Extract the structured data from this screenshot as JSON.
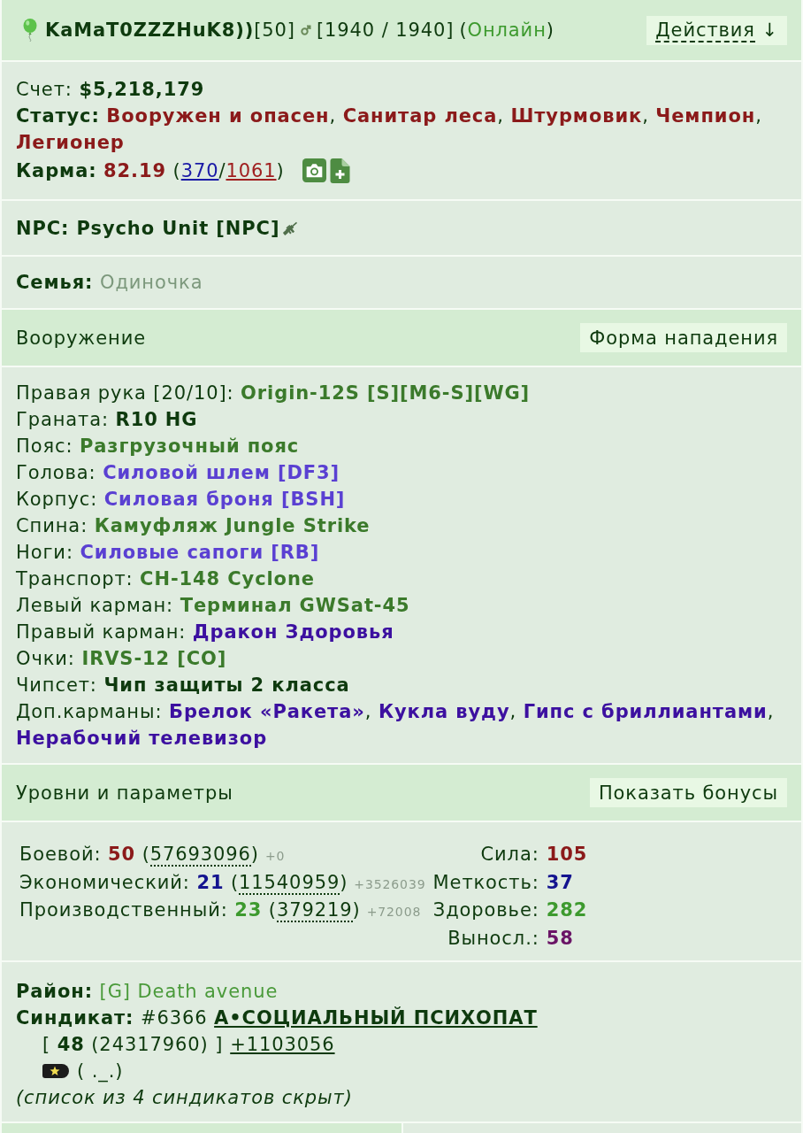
{
  "header": {
    "name": "KaMaT0ZZZHuK8))",
    "level": "[50]",
    "health": "[1940 / 1940]",
    "online_status": {
      "open": "(",
      "label": "Онлайн",
      "close": ")"
    },
    "actions_button": {
      "label": "Действия",
      "arrow": "↓"
    }
  },
  "account": {
    "label": "Счет:",
    "value": "$5,218,179"
  },
  "status": {
    "label": "Статус:",
    "titles": [
      "Вооружен и опасен",
      "Санитар леса",
      "Штурмовик",
      "Чемпион",
      "Легионер"
    ],
    "separator": ","
  },
  "karma": {
    "label": "Карма:",
    "value": "82.19",
    "open": "(",
    "plus_votes": "370",
    "slash": "/",
    "minus_votes": "1061",
    "close": ")"
  },
  "npc": {
    "label": "NPC:",
    "name": "Psycho Unit [NPC]"
  },
  "family": {
    "label": "Семья:",
    "value": "Одиночка"
  },
  "weapons_section": {
    "title": "Вооружение",
    "button": "Форма нападения"
  },
  "equipment": {
    "separator": ",",
    "slots": [
      {
        "label": "Правая рука [20/10]:",
        "items": [
          {
            "name": "Origin-12S [S][M6-S][WG]",
            "color": "#3b7a2b"
          }
        ]
      },
      {
        "label": "Граната:",
        "items": [
          {
            "name": "R10 HG",
            "color": "#0e3a0e"
          }
        ]
      },
      {
        "label": "Пояс:",
        "items": [
          {
            "name": "Разгрузочный пояс",
            "color": "#3b7a2b"
          }
        ]
      },
      {
        "label": "Голова:",
        "items": [
          {
            "name": "Силовой шлем [DF3]",
            "color": "#5a40d2"
          }
        ]
      },
      {
        "label": "Корпус:",
        "items": [
          {
            "name": "Силовая броня [BSH]",
            "color": "#5a40d2"
          }
        ]
      },
      {
        "label": "Спина:",
        "items": [
          {
            "name": "Камуфляж Jungle Strike",
            "color": "#3b7a2b"
          }
        ]
      },
      {
        "label": "Ноги:",
        "items": [
          {
            "name": "Силовые сапоги [RB]",
            "color": "#5a40d2"
          }
        ]
      },
      {
        "label": "Транспорт:",
        "items": [
          {
            "name": "CH-148 Cyclone",
            "color": "#3b7a2b"
          }
        ]
      },
      {
        "label": "Левый карман:",
        "items": [
          {
            "name": "Терминал GWSat-45",
            "color": "#3b7a2b"
          }
        ]
      },
      {
        "label": "Правый карман:",
        "items": [
          {
            "name": "Дракон Здоровья",
            "color": "#3c10a0"
          }
        ]
      },
      {
        "label": "Очки:",
        "items": [
          {
            "name": "IRVS-12 [CO]",
            "color": "#3b7a2b"
          }
        ]
      },
      {
        "label": "Чипсет:",
        "items": [
          {
            "name": "Чип защиты 2 класса",
            "color": "#0e3a0e"
          }
        ]
      },
      {
        "label": "Доп.карманы:",
        "items": [
          {
            "name": "Брелок «Ракета»",
            "color": "#3c10a0"
          },
          {
            "name": "Кукла вуду",
            "color": "#3c10a0"
          },
          {
            "name": "Гипс с бриллиантами",
            "color": "#3c10a0"
          },
          {
            "name": "Нерабочий телевизор",
            "color": "#3c10a0"
          }
        ]
      }
    ]
  },
  "levels_section": {
    "title": "Уровни и параметры",
    "button": "Показать бонусы"
  },
  "levels": [
    {
      "label": "Боевой:",
      "value": "50",
      "color": "#8b1a1a",
      "open": "(",
      "experience": "57693096",
      "close": ")",
      "gain": "+0"
    },
    {
      "label": "Экономический:",
      "value": "21",
      "color": "#14148f",
      "open": "(",
      "experience": "11540959",
      "close": ")",
      "gain": "+3526039"
    },
    {
      "label": "Производственный:",
      "value": "23",
      "color": "#3d9a2e",
      "open": "(",
      "experience": "379219",
      "close": ")",
      "gain": "+72008"
    }
  ],
  "stats": [
    {
      "label": "Сила:",
      "value": "105",
      "color": "#8b1a1a"
    },
    {
      "label": "Меткость:",
      "value": "37",
      "color": "#14148f"
    },
    {
      "label": "Здоровье:",
      "value": "282",
      "color": "#3d9a2e"
    },
    {
      "label": "Выносл.:",
      "value": "58",
      "color": "#6a1466"
    }
  ],
  "district": {
    "label": "Район:",
    "value": "[G] Death avenue"
  },
  "syndicate": {
    "label": "Синдикат:",
    "number": "#6366",
    "name": "А•СОЦИАЛЬНЫЙ ПСИХОПАТ",
    "level_points": "[ **48** (24317960) ]",
    "gain": "+1103056",
    "rank": "( ._.)",
    "hidden_note": "(список из 4 синдикатов скрыт)"
  }
}
